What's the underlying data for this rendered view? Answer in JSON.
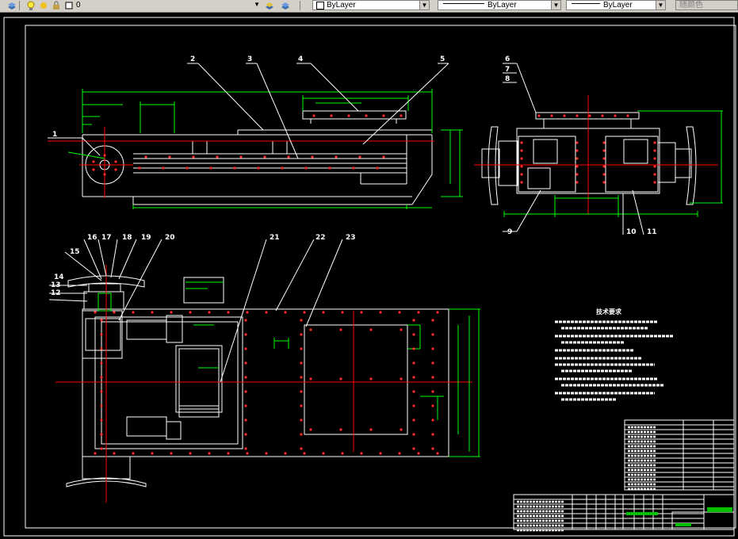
{
  "toolbar": {
    "layer_name": "0",
    "color_value": "ByLayer",
    "linetype_value": "ByLayer",
    "lineweight_value": "ByLayer",
    "plotstyle_value": "随颜色"
  },
  "callouts": [
    "1",
    "2",
    "3",
    "4",
    "5",
    "6",
    "7",
    "8",
    "9",
    "10",
    "11",
    "12",
    "13",
    "14",
    "15",
    "16",
    "17",
    "18",
    "19",
    "20",
    "21",
    "22",
    "23"
  ],
  "notes": {
    "title": "技术要求"
  }
}
